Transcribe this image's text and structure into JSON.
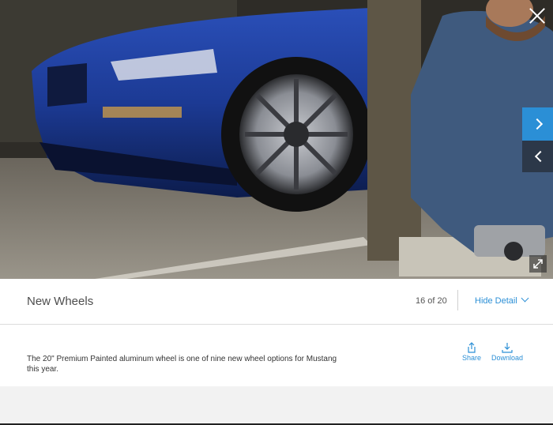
{
  "viewer": {
    "close_icon": "close-icon",
    "next_icon": "chevron-right-icon",
    "prev_icon": "chevron-left-icon",
    "expand_icon": "expand-icon",
    "accent_color": "#2b8fd6"
  },
  "header": {
    "title": "New Wheels",
    "counter": "16 of 20",
    "hide_detail_label": "Hide Detail"
  },
  "detail": {
    "caption": "The 20\" Premium Painted aluminum wheel is one of nine new wheel options for Mustang this year.",
    "share_label": "Share",
    "download_label": "Download"
  }
}
